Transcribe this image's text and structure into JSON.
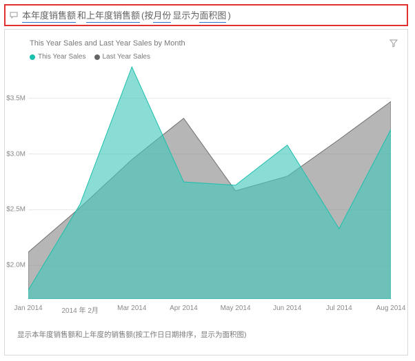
{
  "qna": {
    "tokens": [
      {
        "text": "本年度销售额",
        "underline": true
      },
      {
        "text": "和",
        "underline": false
      },
      {
        "text": "上年度销售额",
        "underline": true
      },
      {
        "text": "(按",
        "underline": false
      },
      {
        "text": "月份",
        "underline": true
      },
      {
        "text": "显示为",
        "underline": false
      },
      {
        "text": "面积图",
        "underline": true
      },
      {
        "text": ")",
        "underline": false
      }
    ]
  },
  "chart": {
    "title": "This Year Sales and Last Year Sales by Month",
    "legend": [
      {
        "label": "This Year Sales",
        "color": "#1bbfae"
      },
      {
        "label": "Last Year Sales",
        "color": "#666666"
      }
    ],
    "y_ticks": [
      "$2.0M",
      "$2.5M",
      "$3.0M",
      "$3.5M"
    ]
  },
  "restatement": "显示本年度销售额和上年度的销售额(按工作日日期排序，显示为面积图)",
  "colors": {
    "seriesA": "#1bbfae",
    "seriesA_fill": "rgba(64,200,187,0.62)",
    "seriesB": "#6f6f6f",
    "seriesB_fill": "rgba(130,130,130,0.58)"
  },
  "chart_data": {
    "type": "area",
    "title": "This Year Sales and Last Year Sales by Month",
    "xlabel": "",
    "ylabel": "",
    "ylim": [
      1700000,
      3800000
    ],
    "y_ticks": [
      2000000,
      2500000,
      3000000,
      3500000
    ],
    "categories": [
      "Jan 2014",
      "2014 年 2月",
      "Mar 2014",
      "Apr 2014",
      "May 2014",
      "Jun 2014",
      "Jul 2014",
      "Aug 2014"
    ],
    "series": [
      {
        "name": "This Year Sales",
        "color": "#1bbfae",
        "values": [
          1780000,
          2550000,
          3780000,
          2750000,
          2720000,
          3080000,
          2330000,
          3220000
        ]
      },
      {
        "name": "Last Year Sales",
        "color": "#6f6f6f",
        "values": [
          2120000,
          2520000,
          2950000,
          3320000,
          2670000,
          2800000,
          3130000,
          3470000
        ]
      }
    ]
  }
}
